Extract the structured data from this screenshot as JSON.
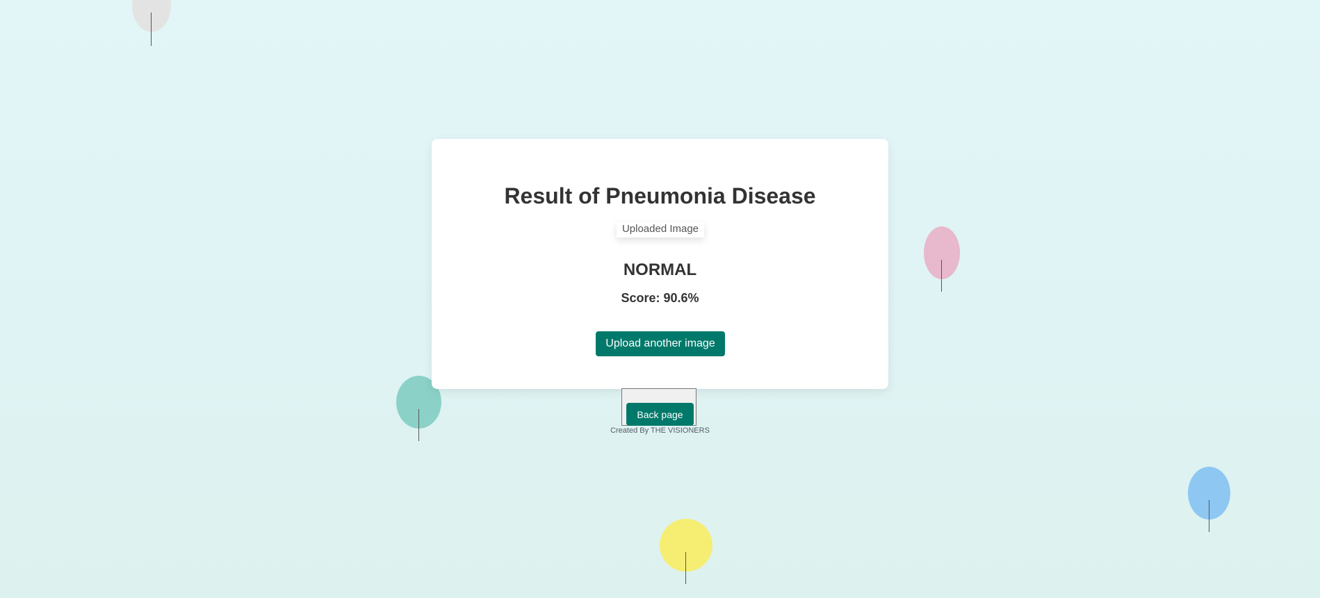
{
  "card": {
    "title": "Result of Pneumonia Disease",
    "image_alt": "Uploaded Image",
    "result": "NORMAL",
    "score": "Score: 90.6%",
    "upload_button": "Upload another image"
  },
  "navigation": {
    "back_button": "Back page"
  },
  "footer": {
    "credit": "Created By THE VISIONERS"
  },
  "colors": {
    "accent": "#00796b",
    "background": "#e0f4f5",
    "balloons": [
      "#e3e3e3",
      "#e8b8cc",
      "#8cd1c8",
      "#8dc7f2",
      "#f6ee72"
    ]
  }
}
